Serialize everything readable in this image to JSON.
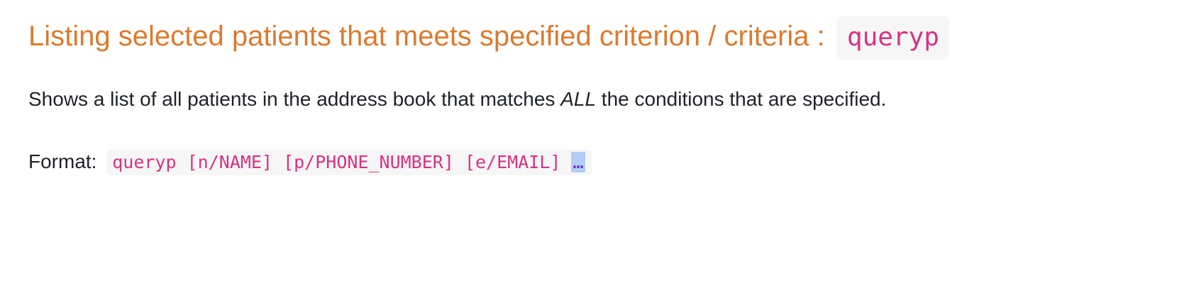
{
  "section": {
    "heading_text": "Listing selected patients that meets specified criterion / criteria :",
    "heading_code": "queryp",
    "description_before": "Shows a list of all patients in the address book that matches ",
    "description_emphasis": "ALL",
    "description_after": " the conditions that are specified.",
    "format_label": "Format:",
    "format_code": "queryp [n/NAME] [p/PHONE_NUMBER] [e/EMAIL]",
    "format_ellipsis": "…"
  },
  "colors": {
    "heading": "#d97b30",
    "code_text": "#d63384",
    "code_background": "#f6f6f6",
    "selection_highlight": "#b3cdf5"
  }
}
